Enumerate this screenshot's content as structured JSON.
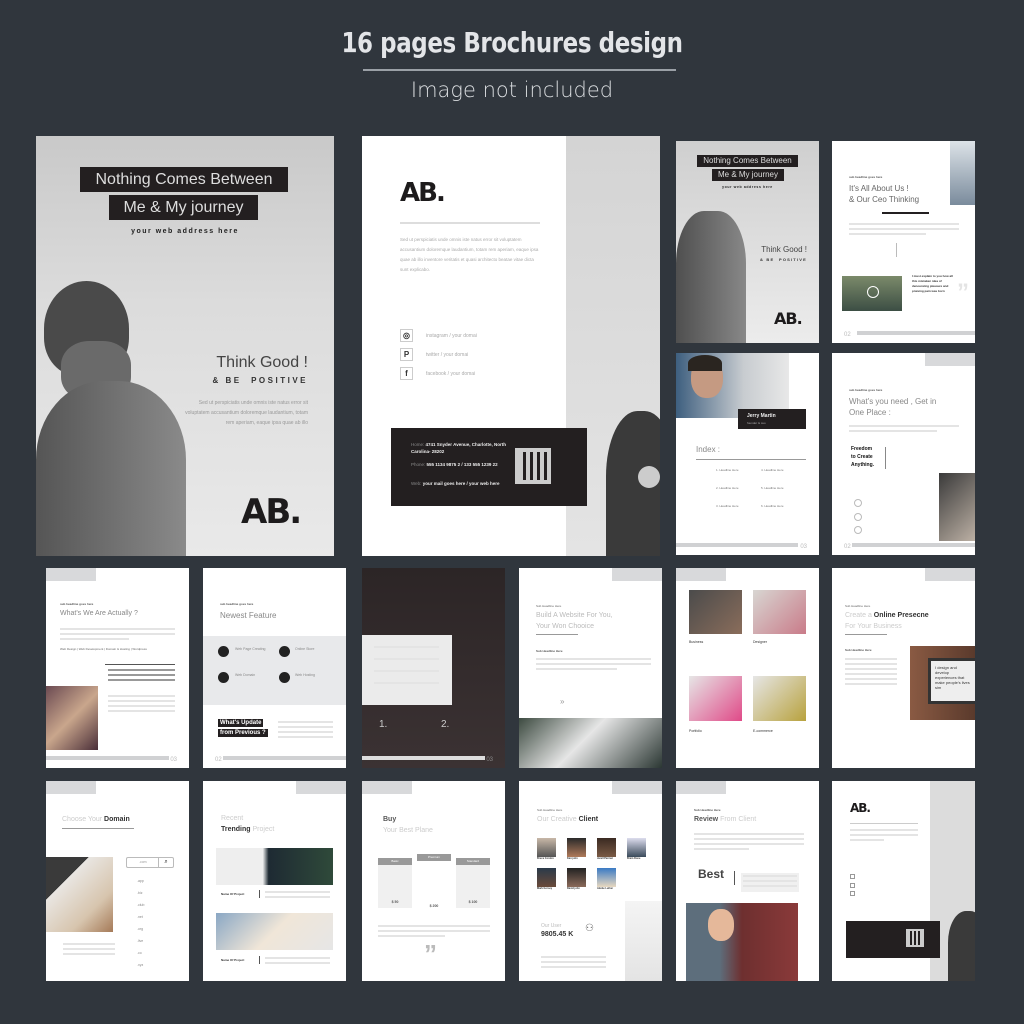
{
  "header": {
    "title": "16 pages Brochures design",
    "subtitle": "Image not included"
  },
  "cover": {
    "title_line1": "Nothing Comes Between",
    "title_line2": "Me & My journey",
    "web": "your web address here",
    "think": "Think Good !",
    "positive": "& BE  POSITIVE",
    "body": "Sed ut perspiciatis unde omnis iste natus error sit voluptatem accusantium doloremque laudantium, totam rem aperiam, eaque ipsa quae ab illo",
    "logo": "AB."
  },
  "back": {
    "logo": "AB.",
    "body": "Sed ut perspiciatis unde omnis iste natus error sit voluptatem accusantium doloremque laudantium, totam rem aperiam, eaque ipsa quae ab illo inventore veritatis et quasi architecto beatae vitae dicta sunt explicabo.",
    "social": [
      {
        "icon": "instagram-icon",
        "glyph": "◎",
        "label": "instagram / your domai"
      },
      {
        "icon": "pinterest-icon",
        "glyph": "P",
        "label": "twitter / your domai"
      },
      {
        "icon": "facebook-icon",
        "glyph": "f",
        "label": "facebook / your domai"
      }
    ],
    "contact": {
      "home_label": "Home:",
      "home": "4741 Snyder Avenue, Charlotte, North Carolina- 28202",
      "phone_label": "Phone:",
      "phone": "555 1134 9875 2 / 133 555 1239 22",
      "web_label": "Web:",
      "web": "your mail goes here / your web here"
    }
  },
  "thumbs": {
    "p_cover": {
      "l1": "Nothing Comes Between",
      "l2": "Me & My journey",
      "web": "your web address here",
      "think": "Think Good !",
      "pos": "& BE  POSITIVE",
      "logo": "AB."
    },
    "p_about": {
      "sub": "sub headline goes here",
      "title1": "It's All About Us !",
      "title2": "& Our Ceo Thinking",
      "quote": "I must explain to you how all this mistaken idea of denouncing pleasure and praising pain was born",
      "page": "02"
    },
    "p_index": {
      "name": "Jerry Martin",
      "role": "founder & ceo",
      "title": "Index :",
      "items": [
        "1. Headline Here",
        "4. Headline Here",
        "2. Headline Here",
        "5. Headline Here",
        "3. Headline Here",
        "6. Headline Here"
      ],
      "page": "03"
    },
    "p_need": {
      "sub": "sub headline goes here",
      "title1": "What's you need , Get in",
      "title2": "One Place :",
      "freedom1": "Freedom",
      "freedom2": "to Create",
      "freedom3": "Anything.",
      "page": "02"
    },
    "p_actually": {
      "sub": "sub headline goes here",
      "title": "What's We Are Actually ?",
      "services": "Web Design | Web Development | Domain & Hosting | Wordpress",
      "page": "03"
    },
    "p_feature": {
      "sub": "sub headline goes here",
      "title": "Newest Feature",
      "features": [
        "Web Page Creating",
        "Online Store",
        "Web Domain",
        "Web Hosting"
      ],
      "update1": "What's Update",
      "update2": "from Previous ?",
      "page": "02"
    },
    "p_dark": {
      "n1": "1.",
      "n2": "2.",
      "page": "03"
    },
    "p_build": {
      "sub": "Sub Headline Here",
      "title1": "Build A Website For You,",
      "title2": "Your Won Chooice",
      "sub2": "Sub Headline Here"
    },
    "p_grid": {
      "items": [
        "Business",
        "Designer",
        "Portfolio",
        "E-commerce"
      ]
    },
    "p_online": {
      "sub": "Sub Headline Here",
      "t1": "Create a ",
      "t2": "Online Presecne",
      "t3": "For Your Business",
      "sub2": "Sub Headline Here",
      "screen": "I design and develop experiences that make people's lives sim"
    },
    "p_domain": {
      "t1": "Choose Your ",
      "t2": "Domain",
      "search": ".com",
      "tlds": [
        ".app",
        ".biz",
        ".club",
        ".net",
        ".org",
        ".live",
        ".co",
        ".xyz"
      ]
    },
    "p_trending": {
      "t1": "Recent",
      "t2": "Trending",
      "t3": " Project",
      "project1": "Name Of Project",
      "project2": "Name Of Project"
    },
    "p_plans": {
      "t1": "Buy",
      "t2": "Your Best Plane",
      "plans": [
        {
          "name": "Basic",
          "price": "$ 50"
        },
        {
          "name": "Premium",
          "price": "$ 200"
        },
        {
          "name": "Standard",
          "price": "$ 100"
        }
      ]
    },
    "p_client": {
      "sub": "Sub Headline Here",
      "t1": "Our Creative ",
      "t2": "Client",
      "clients": [
        "Bruce Cordon",
        "Kan john",
        "Jarell Parmat",
        "Brain Done",
        "Mark Gorsey",
        "David john",
        "Adebe Luther"
      ],
      "user_label": "Our User",
      "user_count": "9805.45 K"
    },
    "p_review": {
      "sub": "Sub Headline Here",
      "t1": "Review",
      "t2": " From Client",
      "best": "Best"
    },
    "p_back": {
      "logo": "AB."
    }
  }
}
